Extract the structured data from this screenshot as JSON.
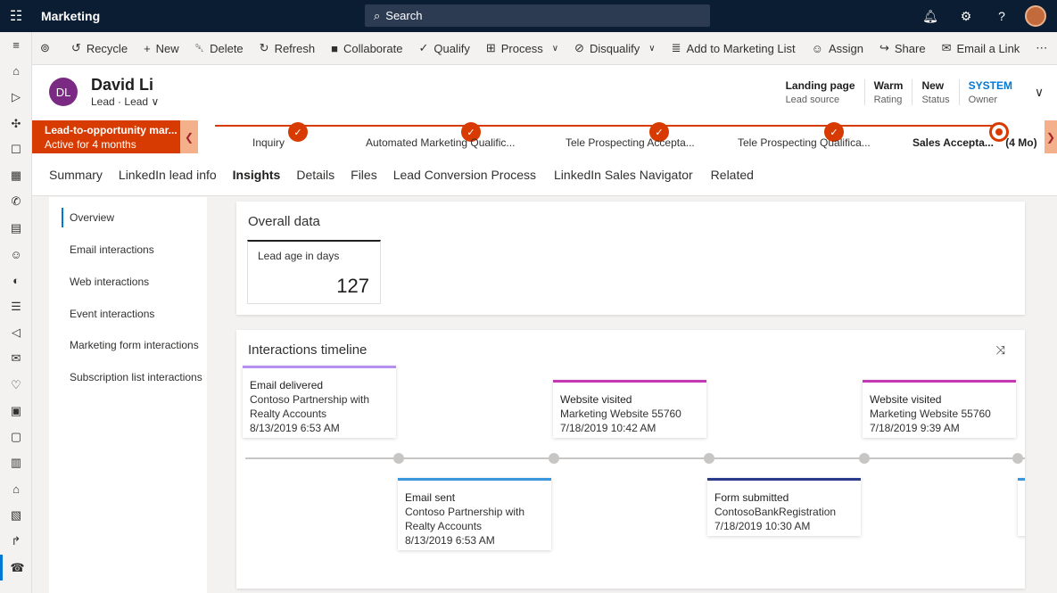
{
  "app": {
    "name": "Marketing"
  },
  "search": {
    "placeholder": "Search"
  },
  "top_icons": [
    "bell-icon",
    "gear-icon",
    "help-icon",
    "user-avatar"
  ],
  "commands": [
    {
      "label": "Recycle",
      "icon": "recycle-icon"
    },
    {
      "label": "New",
      "icon": "plus-icon"
    },
    {
      "label": "Delete",
      "icon": "trash-icon"
    },
    {
      "label": "Refresh",
      "icon": "refresh-icon"
    },
    {
      "label": "Collaborate",
      "icon": "teams-icon"
    },
    {
      "label": "Qualify",
      "icon": "qualify-icon"
    },
    {
      "label": "Process",
      "icon": "process-icon"
    },
    {
      "label": "Disqualify",
      "icon": "disqualify-icon"
    },
    {
      "label": "Add to Marketing List",
      "icon": "list-add-icon"
    },
    {
      "label": "Assign",
      "icon": "assign-icon"
    },
    {
      "label": "Share",
      "icon": "share-icon"
    },
    {
      "label": "Email a Link",
      "icon": "email-link-icon"
    }
  ],
  "record": {
    "initials": "DL",
    "name": "David Li",
    "entity": "Lead",
    "form": "Lead",
    "separator": "·",
    "fields": [
      {
        "value": "Landing page",
        "label": "Lead source"
      },
      {
        "value": "Warm",
        "label": "Rating"
      },
      {
        "value": "New",
        "label": "Status"
      },
      {
        "value": "SYSTEM",
        "label": "Owner"
      }
    ]
  },
  "bpf": {
    "title": "Lead-to-opportunity mar...",
    "subtitle": "Active for 4 months",
    "stages": [
      {
        "label": "Inquiry"
      },
      {
        "label": "Automated Marketing Qualific..."
      },
      {
        "label": "Tele Prospecting Accepta..."
      },
      {
        "label": "Tele Prospecting Qualifica..."
      },
      {
        "label": "Sales Accepta...",
        "duration": "(4 Mo)"
      }
    ]
  },
  "tabs": [
    "Summary",
    "LinkedIn lead info",
    "Insights",
    "Details",
    "Files",
    "Lead Conversion Process",
    "LinkedIn Sales Navigator",
    "Related"
  ],
  "side_menu": [
    "Overview",
    "Email interactions",
    "Web interactions",
    "Event interactions",
    "Marketing form interactions",
    "Subscription list interactions"
  ],
  "overall": {
    "title": "Overall data",
    "kpi_label": "Lead age in days",
    "kpi_value": "127"
  },
  "timeline": {
    "title": "Interactions timeline",
    "items": [
      {
        "type": "Email delivered",
        "lines": [
          "Contoso Partnership with",
          "Realty Accounts"
        ],
        "date": "8/13/2019 6:53 AM",
        "color": "#b491f0"
      },
      {
        "type": "Email sent",
        "lines": [
          "Contoso Partnership with",
          "Realty Accounts"
        ],
        "date": "8/13/2019 6:53 AM",
        "color": "#3a96dd"
      },
      {
        "type": "Website visited",
        "lines": [
          "Marketing Website 55760"
        ],
        "date": "7/18/2019 10:42 AM",
        "color": "#c239b3"
      },
      {
        "type": "Form submitted",
        "lines": [
          "ContosoBankRegistration"
        ],
        "date": "7/18/2019 10:30 AM",
        "color": "#2b3a8c"
      },
      {
        "type": "Website visited",
        "lines": [
          "Marketing Website 55760"
        ],
        "date": "7/18/2019 9:39 AM",
        "color": "#c239b3"
      }
    ]
  }
}
